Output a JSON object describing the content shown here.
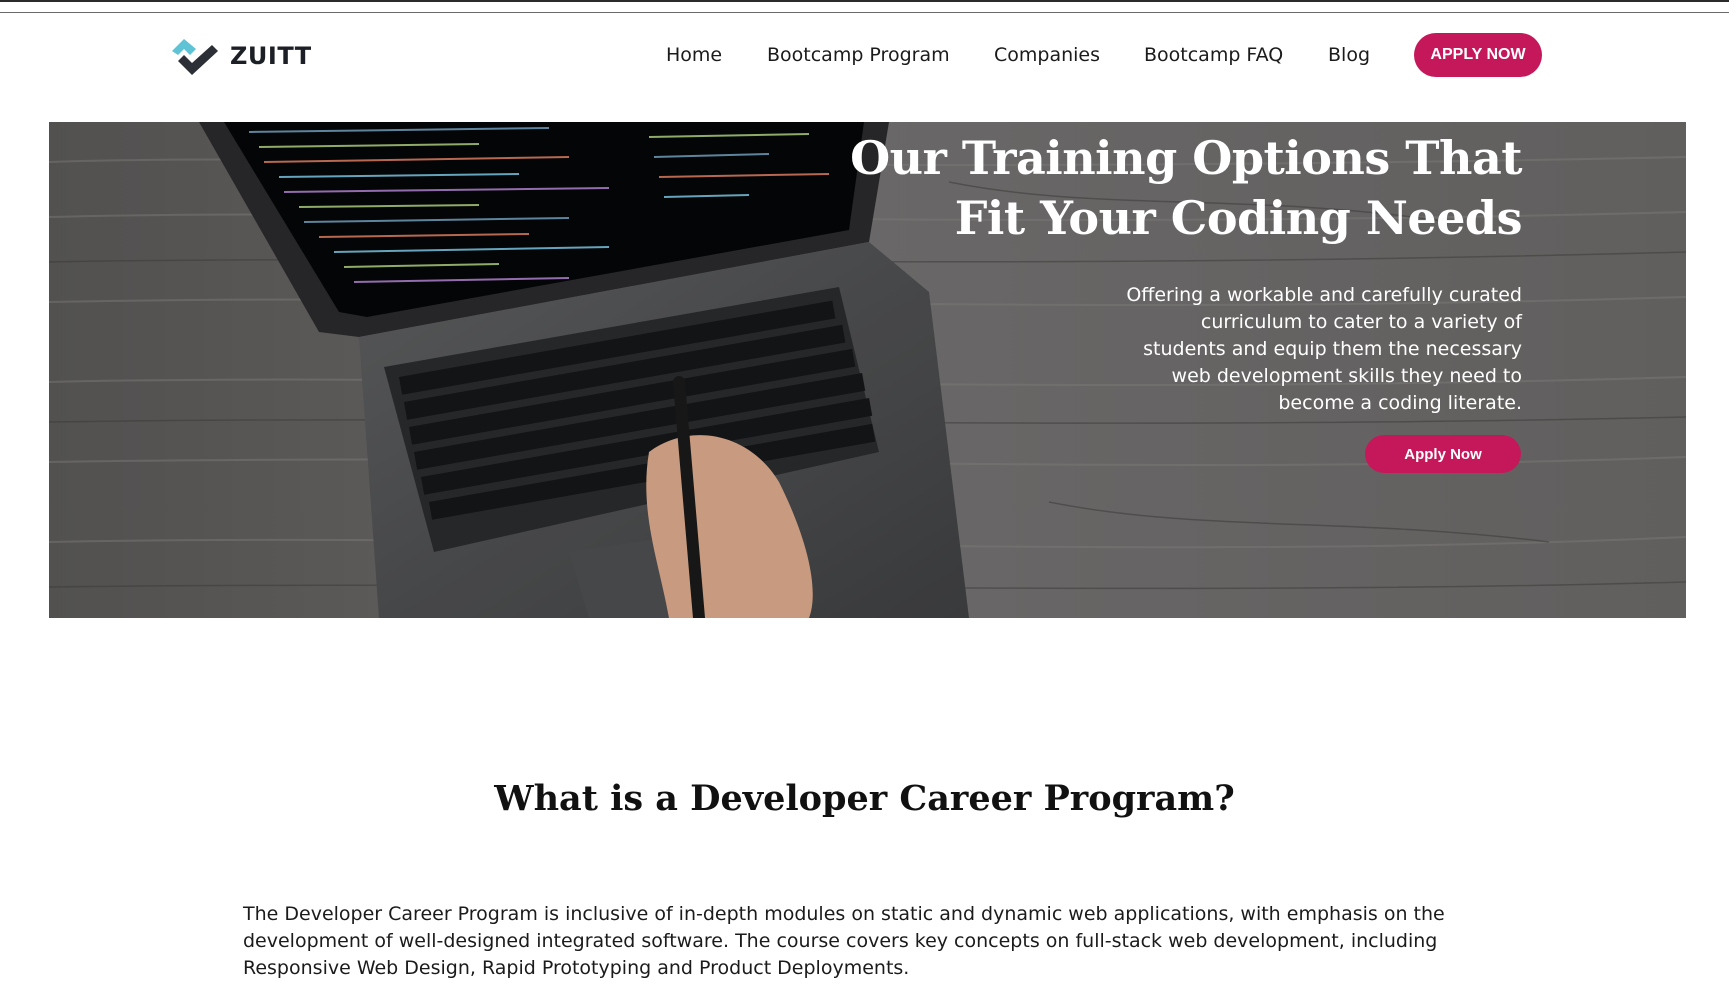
{
  "brand": {
    "name": "ZUITT",
    "logo_icon": "zuitt-check-logo",
    "accent_color": "#c4185a",
    "logo_colors": [
      "#5ec3d4",
      "#2d2f36"
    ]
  },
  "nav": {
    "items": [
      {
        "label": "Home"
      },
      {
        "label": "Bootcamp Program"
      },
      {
        "label": "Companies"
      },
      {
        "label": "Bootcamp FAQ"
      },
      {
        "label": "Blog"
      }
    ],
    "cta_label": "APPLY NOW"
  },
  "hero": {
    "title_lines": [
      "Our Training Options That",
      "Fit Your Coding Needs"
    ],
    "description_lines": [
      "Offering a workable and carefully curated",
      "curriculum to cater to a variety of",
      "students and equip them the necessary",
      "web development skills they need to",
      "become a coding literate."
    ],
    "button_label": "Apply Now",
    "image_subject": "laptop-with-code-on-wooden-desk"
  },
  "section": {
    "title": "What is a Developer Career Program?",
    "body_lines": [
      "The Developer Career Program is inclusive of in-depth modules on static and dynamic web applications, with emphasis on the",
      "development of well-designed integrated software. The course covers key concepts on full-stack web development, including",
      "Responsive Web Design, Rapid Prototyping and Product Deployments."
    ]
  }
}
